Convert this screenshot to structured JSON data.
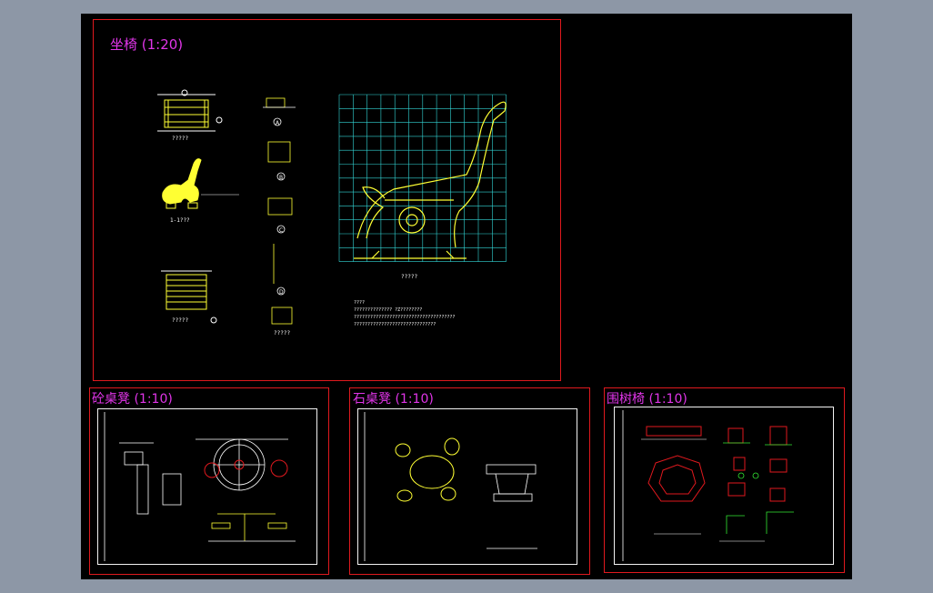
{
  "colors": {
    "workspace": "#8d97a6",
    "canvas": "#000000",
    "frame": "#e0191e",
    "title": "#e035e8",
    "drawing": "#ffff33",
    "grid": "#33d6d6",
    "line": "#ffffff",
    "accent_red": "#e0191e",
    "accent_green": "#33e833"
  },
  "sheets": {
    "bench": {
      "title": "坐椅 (1:20)"
    },
    "concrete_table": {
      "title": "砼桌凳 (1:10)"
    },
    "stone_table": {
      "title": "石桌凳 (1:10)"
    },
    "tree_seat": {
      "title": "围树椅 (1:10)"
    }
  },
  "drawing_labels": {
    "bench_front": "?????",
    "bench_side": "1-1???",
    "bench_plan": "?????",
    "detail_a": "A",
    "detail_b": "B",
    "detail_c": "C",
    "detail_d": "D",
    "detail_e": "?????",
    "grid_view": "?????",
    "notes_title": "????",
    "notes_line1": "??????????????  ?Z????????",
    "notes_line2": "?????????????????????????????????????",
    "notes_line3": "??????????????????????????????"
  },
  "icons": [
    "north-arrow-icon",
    "section-marker-icon"
  ]
}
